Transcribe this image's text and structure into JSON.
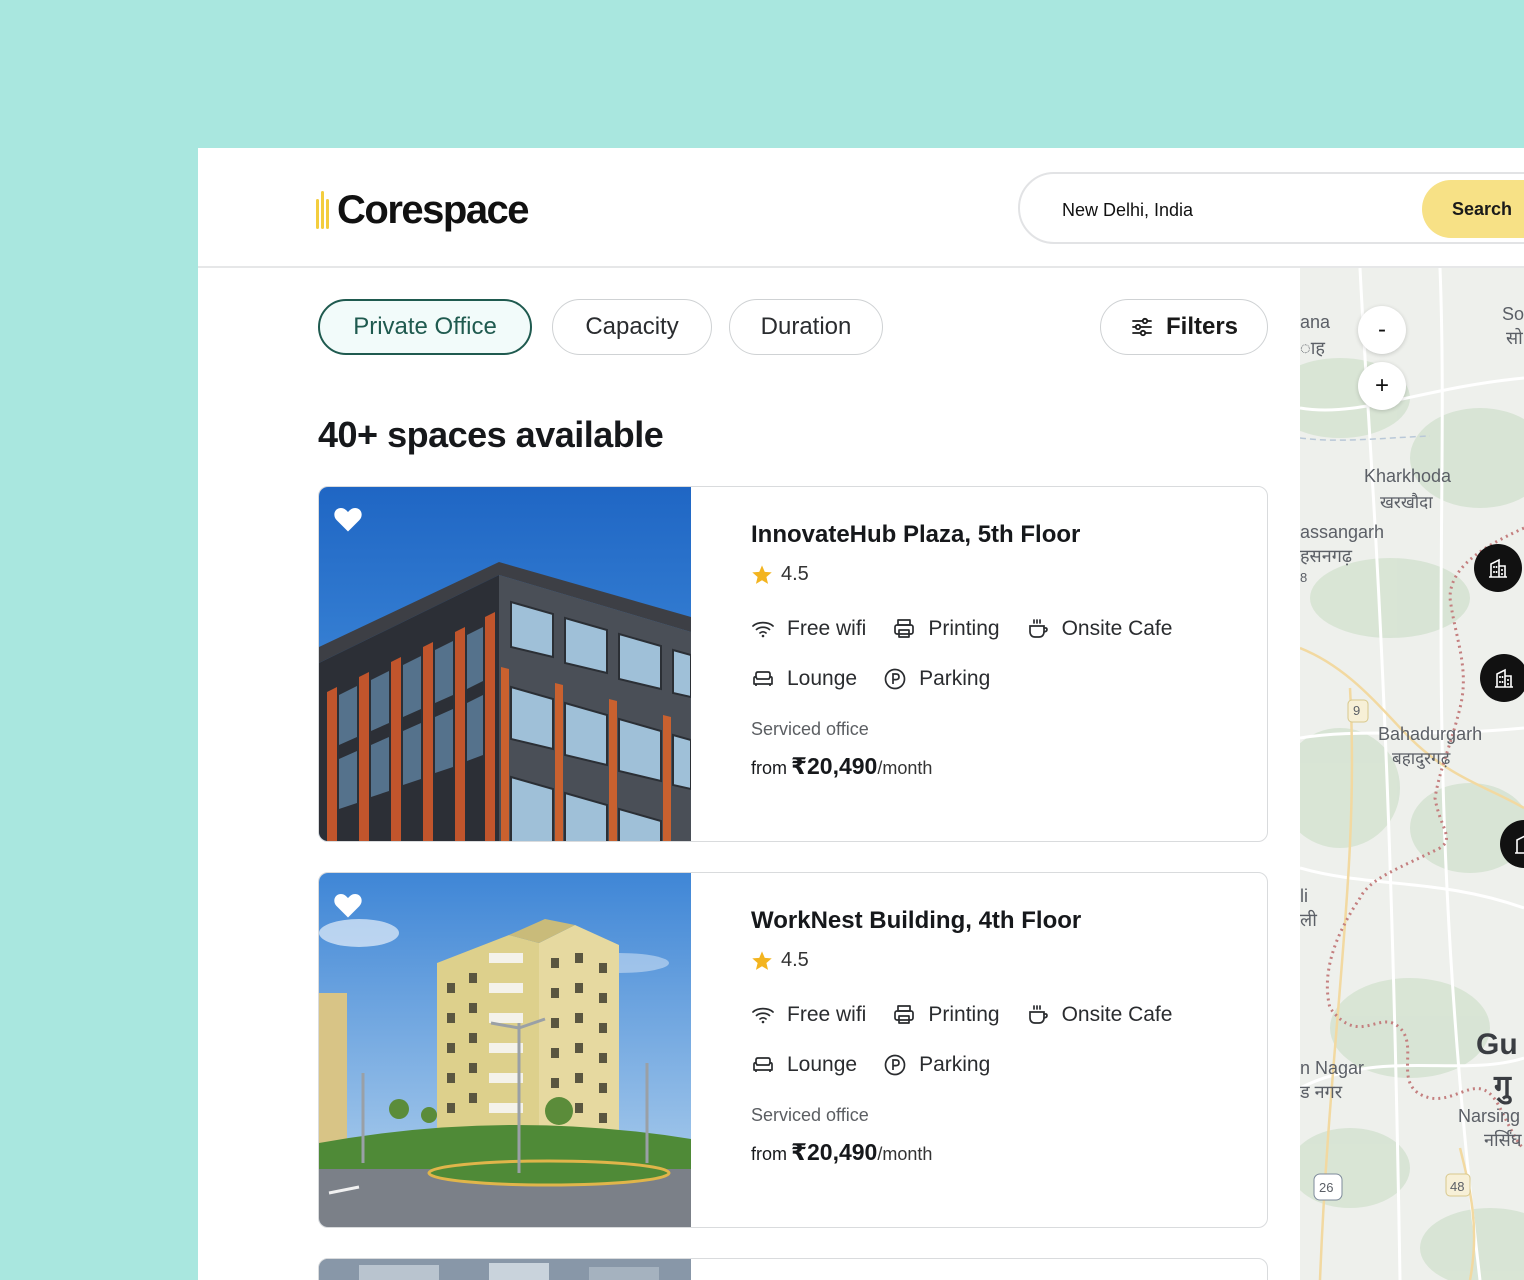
{
  "brand": {
    "name": "Corespace",
    "accent": "#f3cd3d"
  },
  "search": {
    "value": "New Delhi, India",
    "button_label": "Search",
    "button_color": "#f7e186"
  },
  "filters": {
    "chips": [
      {
        "label": "Private Office",
        "active": true
      },
      {
        "label": "Capacity",
        "active": false
      },
      {
        "label": "Duration",
        "active": false
      }
    ],
    "filters_label": "Filters",
    "filters_icon": "sliders-icon"
  },
  "results": {
    "title": "40+ spaces available"
  },
  "listings": [
    {
      "name": "InnovateHub Plaza, 5th Floor",
      "rating": "4.5",
      "amenities": [
        "Free wifi",
        "Printing",
        "Onsite Cafe",
        "Lounge",
        "Parking"
      ],
      "type": "Serviced office",
      "price_prefix": "from",
      "price": "₹20,490",
      "price_suffix": "/month",
      "favorite_icon": "heart-icon"
    },
    {
      "name": "WorkNest Building, 4th Floor",
      "rating": "4.5",
      "amenities": [
        "Free wifi",
        "Printing",
        "Onsite Cafe",
        "Lounge",
        "Parking"
      ],
      "type": "Serviced office",
      "price_prefix": "from",
      "price": "₹20,490",
      "price_suffix": "/month",
      "favorite_icon": "heart-icon"
    }
  ],
  "map": {
    "zoom_out": "-",
    "zoom_in": "+",
    "labels": [
      "ana",
      "ाह",
      "So",
      "सो",
      "Kharkhoda",
      "खरखौदा",
      "assangarh",
      "हसनगढ़",
      "8",
      "9",
      "Bahadurgarh",
      "बहादुरगढ़",
      "li",
      "ली",
      "Gu",
      "गु",
      "n Nagar",
      "ड नगर",
      "Narsing",
      "नर्सिंघ",
      "26",
      "48"
    ]
  }
}
